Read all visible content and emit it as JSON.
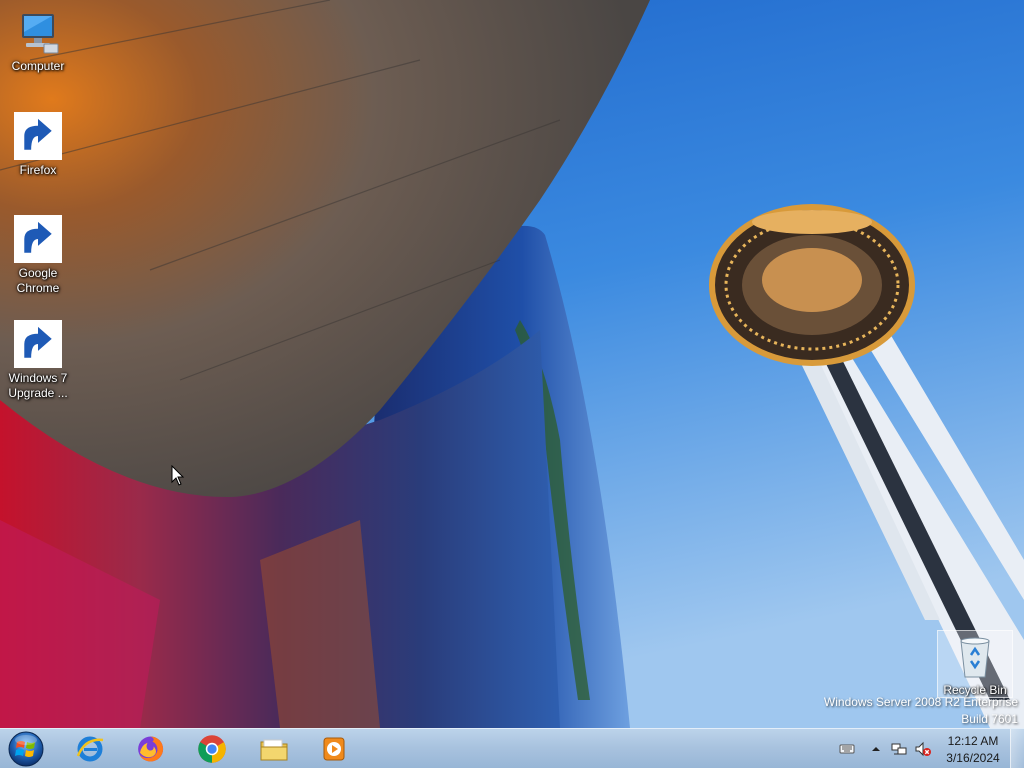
{
  "desktop": {
    "icons": [
      {
        "label": "Computer",
        "icon": "computer-icon"
      },
      {
        "label": "Firefox",
        "icon": "firefox-icon"
      },
      {
        "label": "Google Chrome",
        "icon": "chrome-icon"
      },
      {
        "label": "Windows 7 Upgrade ...",
        "icon": "windows-upgrade-icon"
      }
    ],
    "recycle_bin": {
      "label": "Recycle Bin",
      "icon": "recycle-bin-icon"
    },
    "watermark": {
      "line1": "Windows Server 2008 R2 Enterprise",
      "line2": "Build 7601"
    },
    "wallpaper": {
      "subject": "space-needle-wallpaper"
    }
  },
  "taskbar": {
    "start": {
      "icon": "windows-start-orb-icon"
    },
    "pinned": [
      {
        "name": "Internet Explorer",
        "icon": "internet-explorer-icon"
      },
      {
        "name": "Firefox",
        "icon": "firefox-icon"
      },
      {
        "name": "Google Chrome",
        "icon": "chrome-icon"
      },
      {
        "name": "Windows Explorer",
        "icon": "folder-icon"
      },
      {
        "name": "Windows Media Player",
        "icon": "media-player-icon"
      }
    ],
    "tray": {
      "icons": [
        "keyboard-icon",
        "show-hidden-icons-chevron",
        "network-icon",
        "volume-muted-icon"
      ],
      "time": "12:12 AM",
      "date": "3/16/2024"
    }
  },
  "colors": {
    "sky": "#2f7fd8",
    "taskbar": "#a9c3df",
    "needle_gold": "#d89a3a"
  }
}
